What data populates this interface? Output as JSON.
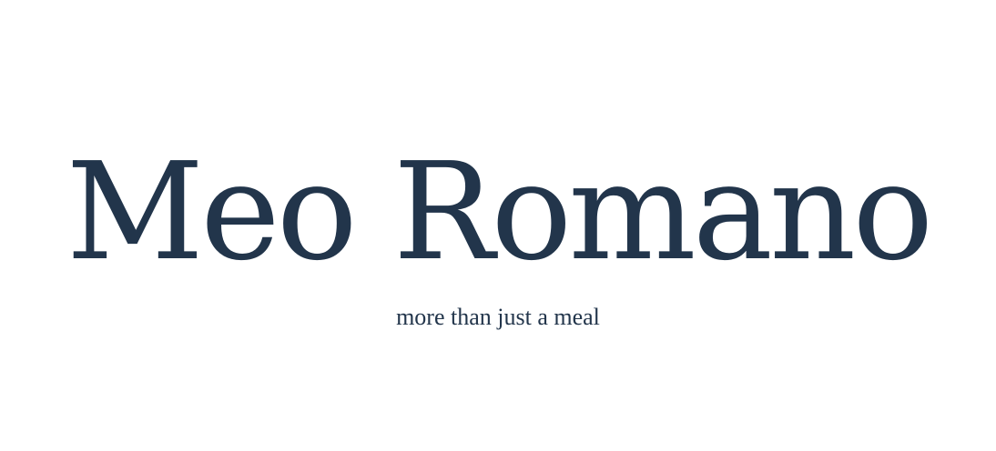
{
  "hero": {
    "title": "Meo Romano",
    "tagline": "more than just a meal"
  },
  "colors": {
    "text": "#22354b",
    "background": "#ffffff"
  }
}
